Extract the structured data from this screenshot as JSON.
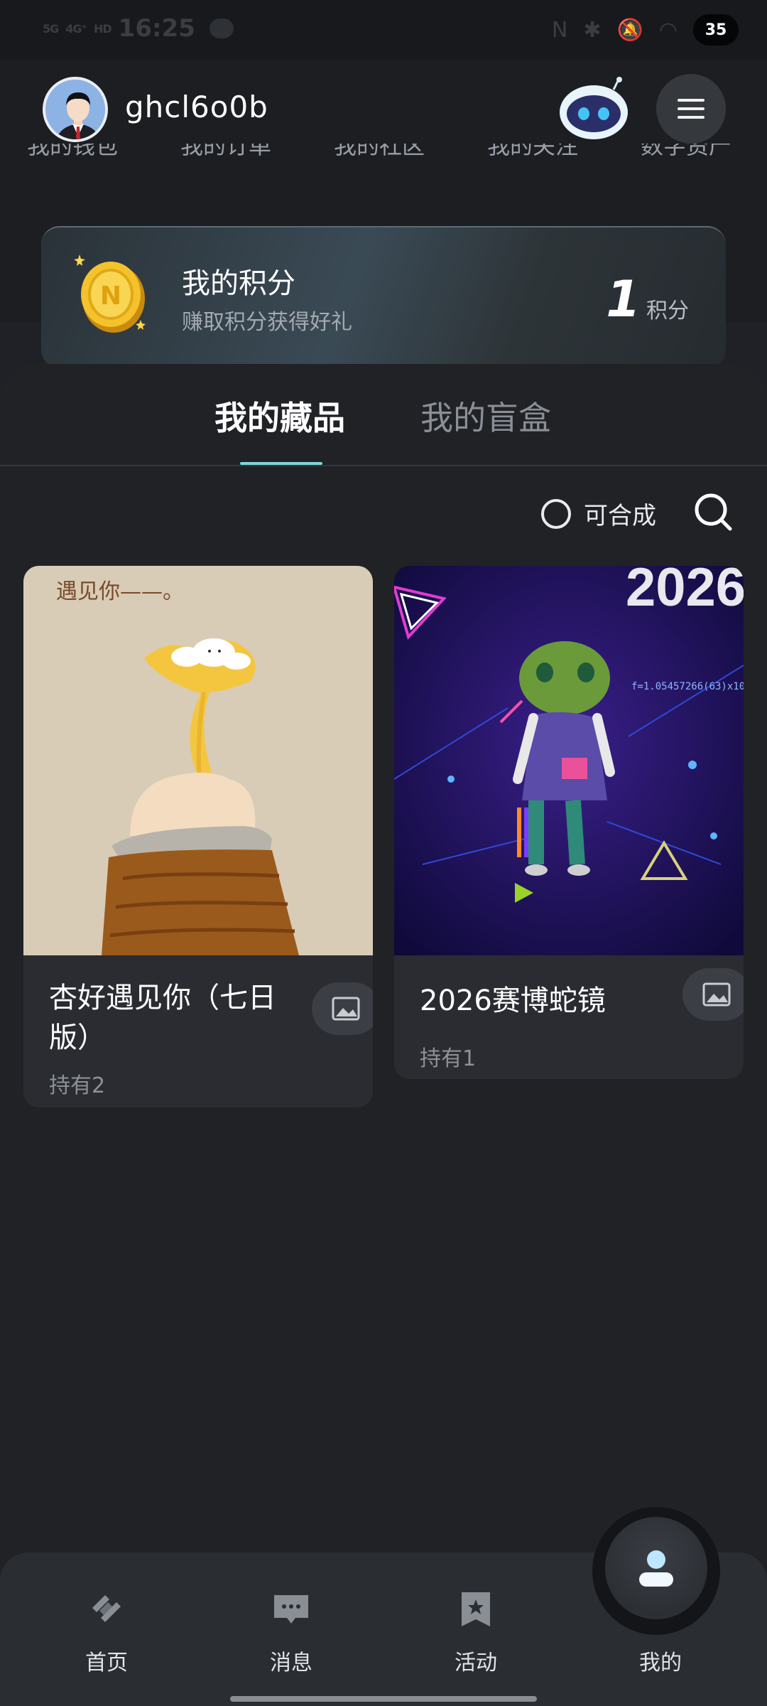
{
  "status_bar": {
    "time": "16:25",
    "signal_1": "5G",
    "signal_2": "4G⁺",
    "hd_label": "HD",
    "battery": "35"
  },
  "header": {
    "username": "ghcl6o0b",
    "quick_links": [
      "我的钱包",
      "我的订单",
      "我的社区",
      "我的关注",
      "数字资产"
    ]
  },
  "points": {
    "title": "我的积分",
    "subtitle": "赚取积分获得好礼",
    "value": "1",
    "unit": "积分"
  },
  "tabs": {
    "active": "我的藏品",
    "inactive": "我的盲盒"
  },
  "filter": {
    "label": "可合成"
  },
  "collection": [
    {
      "title": "杏好遇见你（七日版）",
      "count": "持有2",
      "image_caption": "遇见你——。"
    },
    {
      "title": "2026赛博蛇镜",
      "count": "持有1",
      "image_caption": "2026",
      "formula": "f=1.05457266(63)x10"
    }
  ],
  "nav": {
    "home": "首页",
    "messages": "消息",
    "activity": "活动",
    "mine": "我的"
  },
  "colors": {
    "accent": "#7fd6d8",
    "background": "#202226",
    "card": "#2a2c31"
  }
}
